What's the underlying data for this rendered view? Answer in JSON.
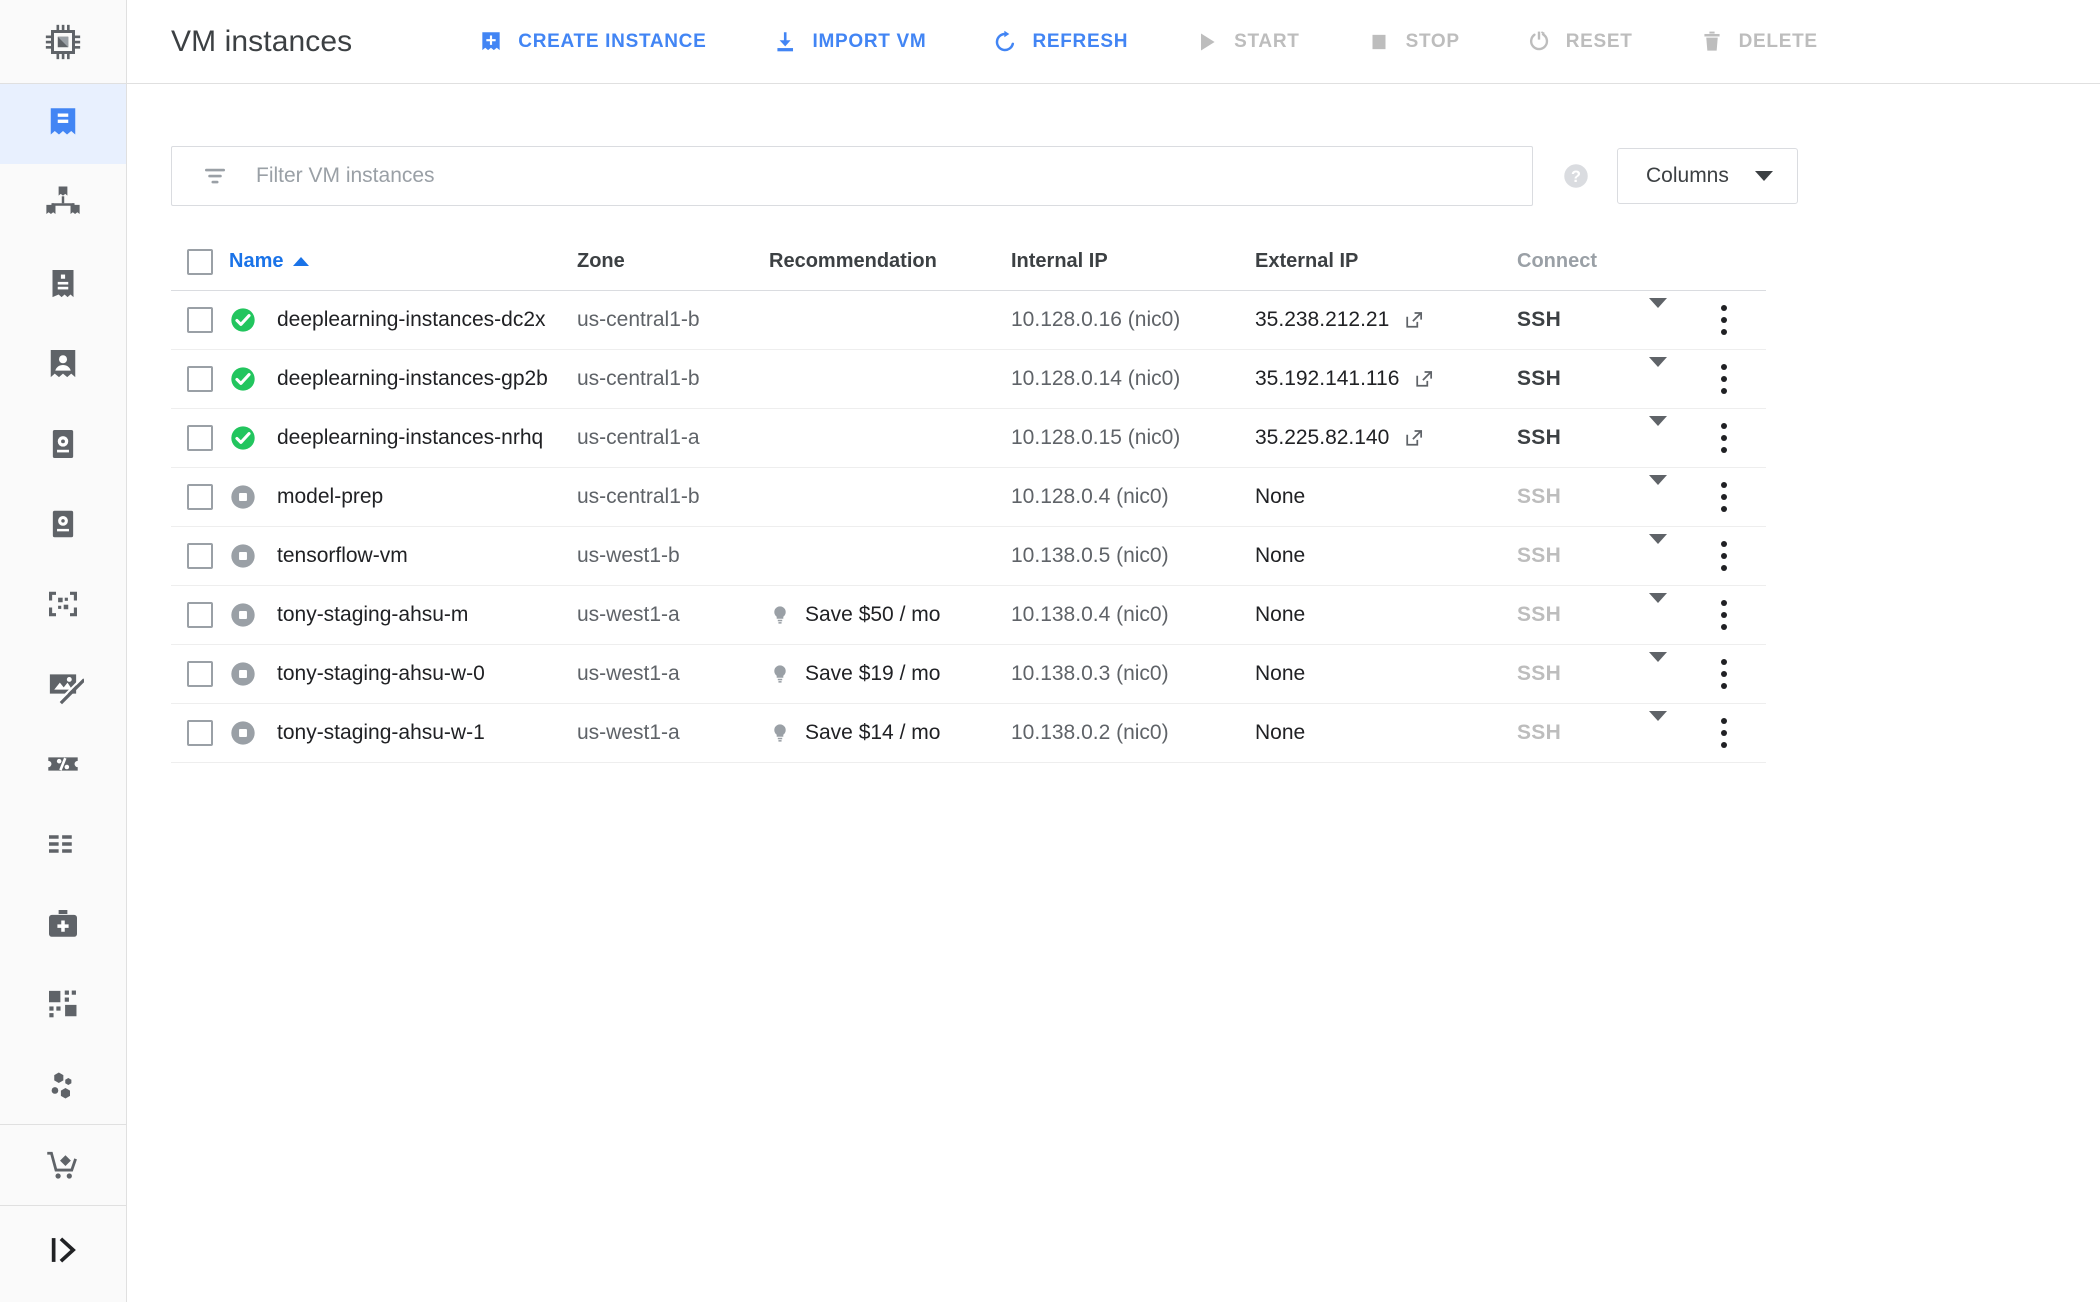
{
  "header": {
    "title": "VM instances",
    "logo_icon": "cpu-chip-icon",
    "actions": [
      {
        "label": "CREATE INSTANCE",
        "icon": "add-instance-icon",
        "enabled": true
      },
      {
        "label": "IMPORT VM",
        "icon": "download-import-icon",
        "enabled": true
      },
      {
        "label": "REFRESH",
        "icon": "refresh-icon",
        "enabled": true
      },
      {
        "label": "START",
        "icon": "play-icon",
        "enabled": false
      },
      {
        "label": "STOP",
        "icon": "stop-square-icon",
        "enabled": false
      },
      {
        "label": "RESET",
        "icon": "power-reset-icon",
        "enabled": false
      },
      {
        "label": "DELETE",
        "icon": "trash-icon",
        "enabled": false
      }
    ]
  },
  "sidebar": {
    "items": [
      {
        "name": "vm-instances",
        "icon": "vm-instances-icon",
        "active": true
      },
      {
        "name": "instance-groups",
        "icon": "instance-groups-icon",
        "active": false
      },
      {
        "name": "instance-templates",
        "icon": "instance-templates-icon",
        "active": false
      },
      {
        "name": "sole-tenant-nodes",
        "icon": "sole-tenant-icon",
        "active": false
      },
      {
        "name": "machine-images",
        "icon": "machine-images-icon",
        "active": false
      },
      {
        "name": "disks",
        "icon": "disks-icon",
        "active": false
      },
      {
        "name": "snapshots",
        "icon": "snapshots-icon",
        "active": false
      },
      {
        "name": "images",
        "icon": "images-icon",
        "active": false
      },
      {
        "name": "committed-use-discounts",
        "icon": "percent-discount-icon",
        "active": false
      },
      {
        "name": "metadata",
        "icon": "metadata-list-icon",
        "active": false
      },
      {
        "name": "health-checks",
        "icon": "health-check-icon",
        "active": false
      },
      {
        "name": "zones",
        "icon": "zones-grid-icon",
        "active": false
      },
      {
        "name": "operations",
        "icon": "operations-molecule-icon",
        "active": false
      },
      {
        "name": "marketplace",
        "icon": "shopping-cart-icon",
        "active": false
      }
    ],
    "collapse_icon": "expand-panel-icon"
  },
  "filter": {
    "icon": "filter-funnel-icon",
    "placeholder": "Filter VM instances",
    "value": "",
    "help_icon": "help-circle-icon",
    "columns_label": "Columns",
    "columns_caret_icon": "chevron-down-icon"
  },
  "table": {
    "columns": [
      {
        "key": "name",
        "label": "Name",
        "sorted": true,
        "sort_dir": "asc"
      },
      {
        "key": "zone",
        "label": "Zone",
        "sorted": false
      },
      {
        "key": "recommendation",
        "label": "Recommendation",
        "sorted": false
      },
      {
        "key": "internal_ip",
        "label": "Internal IP",
        "sorted": false
      },
      {
        "key": "external_ip",
        "label": "External IP",
        "sorted": false
      },
      {
        "key": "connect",
        "label": "Connect",
        "sorted": false,
        "muted": true
      }
    ],
    "connect_label": "SSH",
    "rows": [
      {
        "selected": false,
        "status": "running",
        "name": "deeplearning-instances-dc2x",
        "zone": "us-central1-b",
        "recommendation": "",
        "internal_ip": "10.128.0.16 (nic0)",
        "external_ip": "35.238.212.21",
        "external_link": true,
        "connect_enabled": true
      },
      {
        "selected": false,
        "status": "running",
        "name": "deeplearning-instances-gp2b",
        "zone": "us-central1-b",
        "recommendation": "",
        "internal_ip": "10.128.0.14 (nic0)",
        "external_ip": "35.192.141.116",
        "external_link": true,
        "connect_enabled": true
      },
      {
        "selected": false,
        "status": "running",
        "name": "deeplearning-instances-nrhq",
        "zone": "us-central1-a",
        "recommendation": "",
        "internal_ip": "10.128.0.15 (nic0)",
        "external_ip": "35.225.82.140",
        "external_link": true,
        "connect_enabled": true
      },
      {
        "selected": false,
        "status": "stopped",
        "name": "model-prep",
        "zone": "us-central1-b",
        "recommendation": "",
        "internal_ip": "10.128.0.4 (nic0)",
        "external_ip": "None",
        "external_link": false,
        "connect_enabled": false
      },
      {
        "selected": false,
        "status": "stopped",
        "name": "tensorflow-vm",
        "zone": "us-west1-b",
        "recommendation": "",
        "internal_ip": "10.138.0.5 (nic0)",
        "external_ip": "None",
        "external_link": false,
        "connect_enabled": false
      },
      {
        "selected": false,
        "status": "stopped",
        "name": "tony-staging-ahsu-m",
        "zone": "us-west1-a",
        "recommendation": "Save $50 / mo",
        "internal_ip": "10.138.0.4 (nic0)",
        "external_ip": "None",
        "external_link": false,
        "connect_enabled": false
      },
      {
        "selected": false,
        "status": "stopped",
        "name": "tony-staging-ahsu-w-0",
        "zone": "us-west1-a",
        "recommendation": "Save $19 / mo",
        "internal_ip": "10.138.0.3 (nic0)",
        "external_ip": "None",
        "external_link": false,
        "connect_enabled": false
      },
      {
        "selected": false,
        "status": "stopped",
        "name": "tony-staging-ahsu-w-1",
        "zone": "us-west1-a",
        "recommendation": "Save $14 / mo",
        "internal_ip": "10.138.0.2 (nic0)",
        "external_ip": "None",
        "external_link": false,
        "connect_enabled": false
      }
    ]
  },
  "colors": {
    "accent_blue": "#4285f4",
    "link_blue": "#1a73e8",
    "running_green": "#34a853",
    "stopped_gray": "#9aa0a6",
    "disabled_gray": "#bdbdbd",
    "text_primary": "#202124",
    "text_secondary": "#5f6368",
    "sidebar_bg": "#fafafa",
    "active_bg": "#e8f0fe"
  }
}
